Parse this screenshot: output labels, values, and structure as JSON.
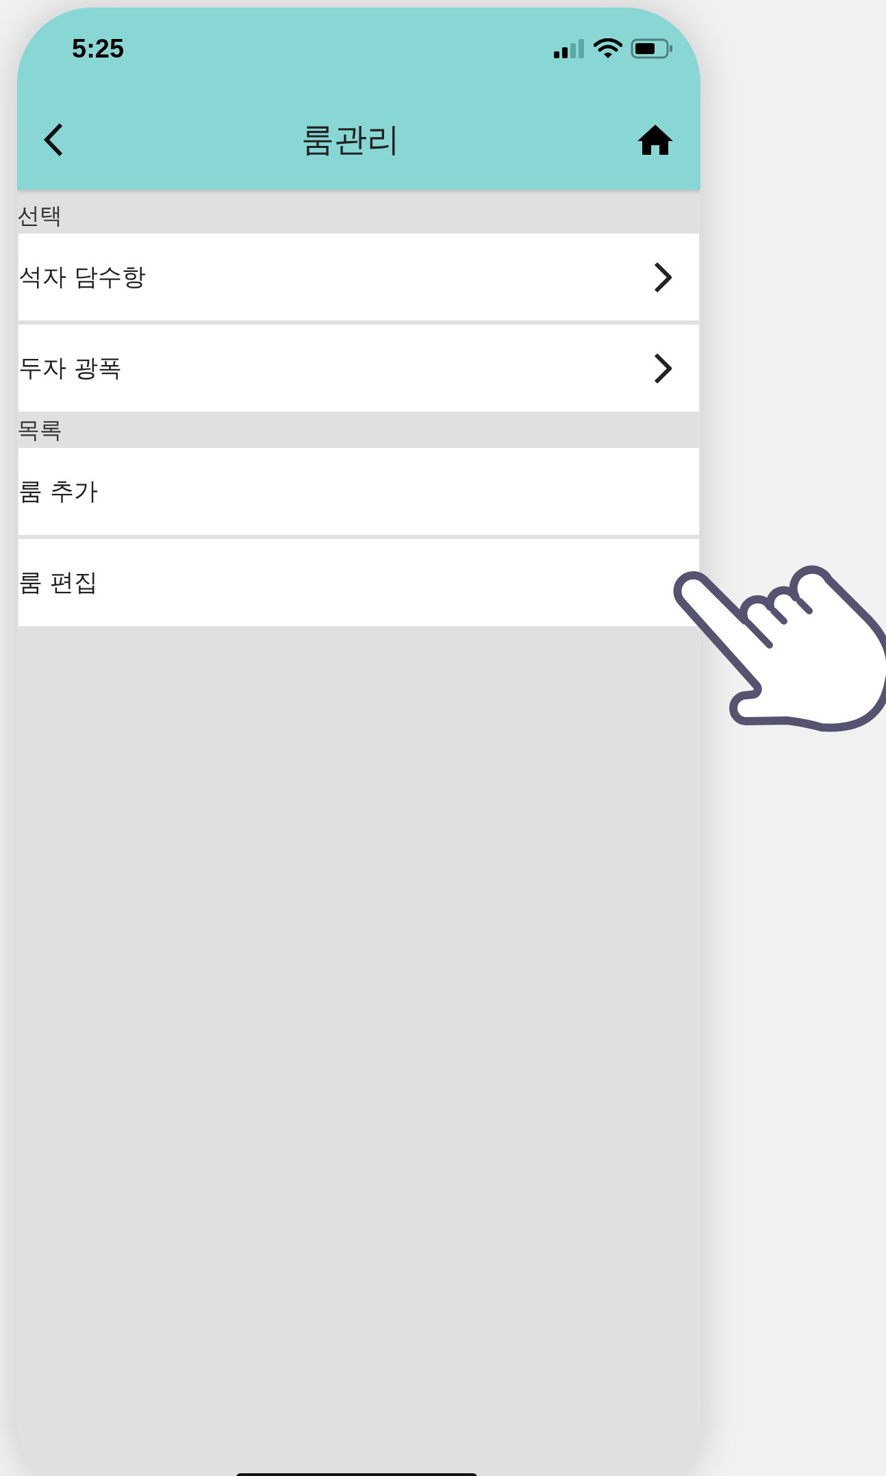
{
  "status_bar": {
    "time": "5:25"
  },
  "header": {
    "title": "룸관리"
  },
  "sections": [
    {
      "label": "선택",
      "items": [
        {
          "label": "석자 담수항",
          "kind": "nav"
        },
        {
          "label": "두자 광폭",
          "kind": "nav"
        }
      ]
    },
    {
      "label": "목록",
      "items": [
        {
          "label": "룸 추가",
          "kind": "action"
        },
        {
          "label": "룸 편집",
          "kind": "action"
        }
      ]
    }
  ]
}
